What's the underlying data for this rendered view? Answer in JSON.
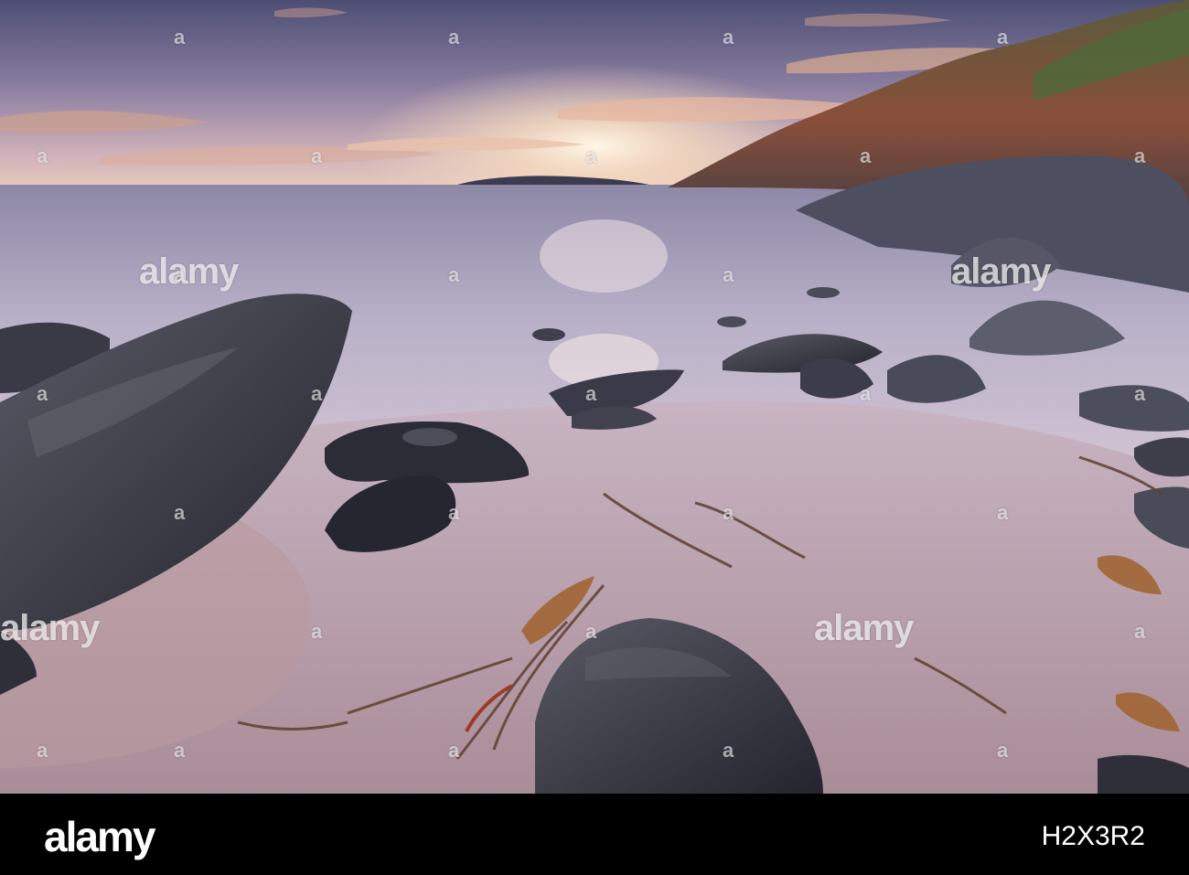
{
  "photo": {
    "description_colors": {
      "sky_top": "#4e4f75",
      "sky_glow": "#f6d9b8",
      "sea": "#a89fb6",
      "sand": "#c3a9b3",
      "rock": "#3a3a48"
    }
  },
  "watermark": {
    "big_text": "alamy",
    "small_text": "a"
  },
  "footer": {
    "logo": "alamy",
    "image_id": "H2X3R2"
  }
}
